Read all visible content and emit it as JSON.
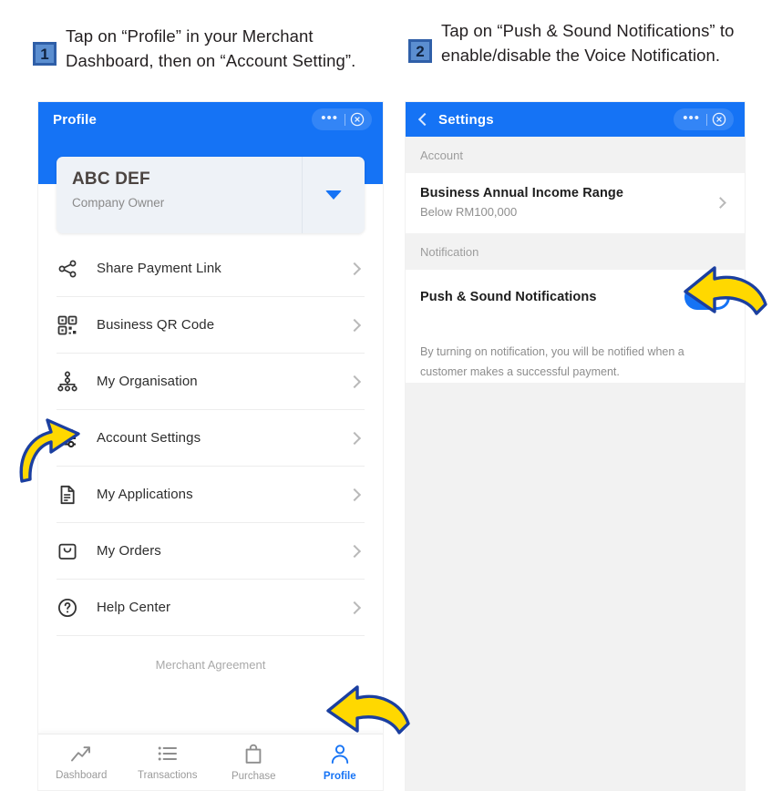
{
  "steps": [
    {
      "number": "1",
      "text": "Tap on “Profile” in your Merchant Dashboard, then on “Account Setting”."
    },
    {
      "number": "2",
      "text": "Tap on “Push & Sound Notifications” to enable/disable the Voice Notification."
    }
  ],
  "colors": {
    "brand_blue": "#1573f5",
    "arrow_yellow": "#ffd800",
    "arrow_outline": "#1b3fa0",
    "badge_fill": "#5b8ed0",
    "badge_border": "#2f5fa8"
  },
  "panel1": {
    "appbar": {
      "title": "Profile",
      "dots": "•••",
      "close_icon": "close-circle-icon"
    },
    "profile_card": {
      "name": "ABC DEF",
      "role": "Company Owner",
      "caret_icon": "chevron-down-icon"
    },
    "menu": [
      {
        "label": "Share Payment Link",
        "icon": "share-icon"
      },
      {
        "label": "Business QR Code",
        "icon": "qr-code-icon"
      },
      {
        "label": "My Organisation",
        "icon": "org-chart-icon"
      },
      {
        "label": "Account Settings",
        "icon": "sliders-icon"
      },
      {
        "label": "My Applications",
        "icon": "document-icon"
      },
      {
        "label": "My Orders",
        "icon": "bag-icon"
      },
      {
        "label": "Help Center",
        "icon": "question-circle-icon"
      }
    ],
    "merchant_agreement": "Merchant Agreement",
    "bottom_nav": [
      {
        "label": "Dashboard",
        "icon": "trending-up-icon",
        "active": false
      },
      {
        "label": "Transactions",
        "icon": "list-icon",
        "active": false
      },
      {
        "label": "Purchase",
        "icon": "shopping-bag-icon",
        "active": false
      },
      {
        "label": "Profile",
        "icon": "person-icon",
        "active": true
      }
    ]
  },
  "panel2": {
    "appbar": {
      "title": "Settings",
      "back_icon": "chevron-left-icon",
      "dots": "•••",
      "close_icon": "close-circle-icon"
    },
    "section_account": "Account",
    "income_row": {
      "title": "Business Annual Income Range",
      "value": "Below RM100,000",
      "chevron_icon": "chevron-right-icon"
    },
    "section_notification": "Notification",
    "notification_row": {
      "label": "Push & Sound Notifications",
      "toggle_state": "on"
    },
    "note": "By turning on notification, you will be notified when a customer makes a successful payment."
  },
  "annotations": [
    {
      "name": "arrow-to-account-settings",
      "direction": "up-right"
    },
    {
      "name": "arrow-to-profile-tab",
      "direction": "down-left"
    },
    {
      "name": "arrow-to-notifications-toggle",
      "direction": "down-left"
    }
  ]
}
